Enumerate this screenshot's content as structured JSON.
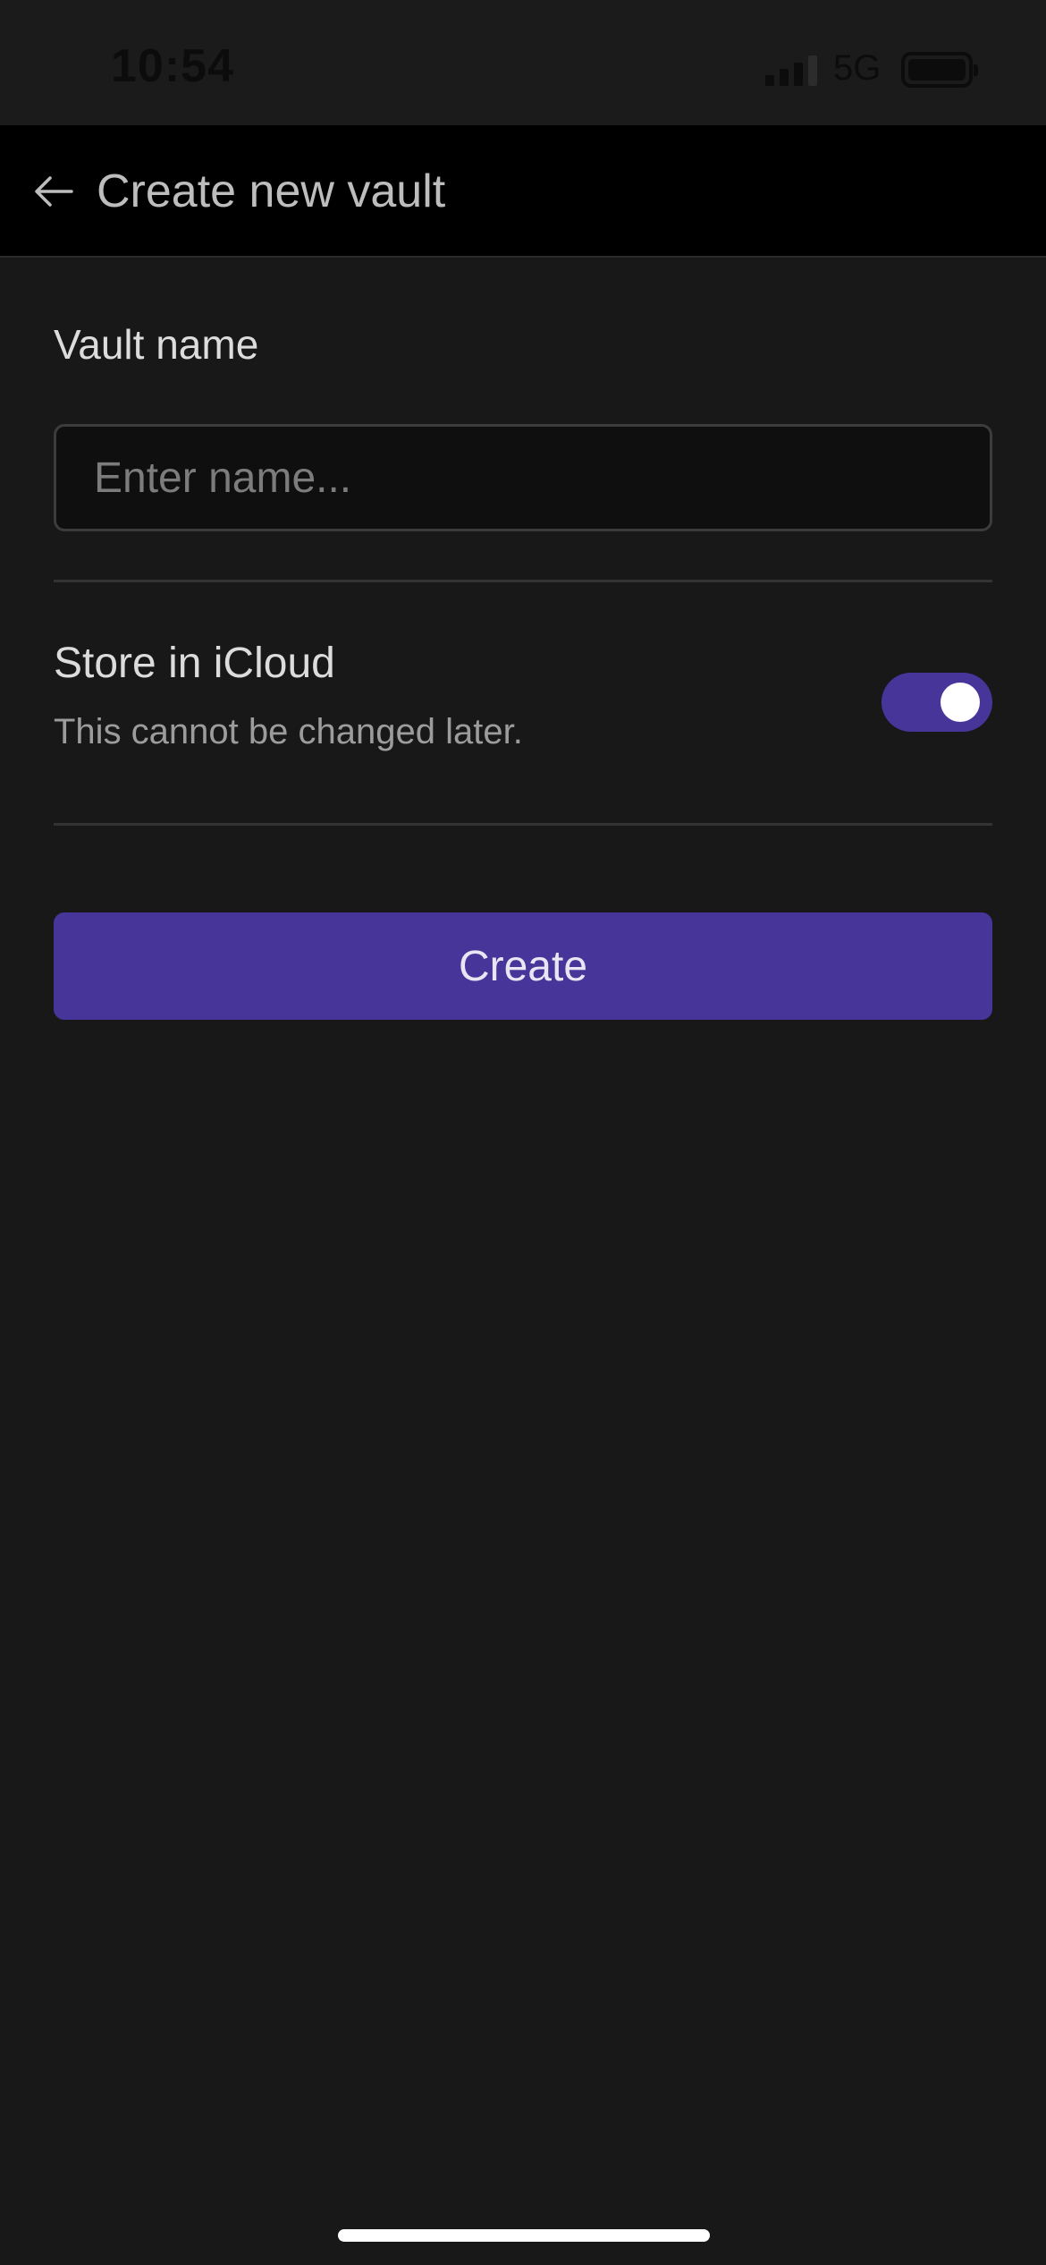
{
  "status_bar": {
    "time": "10:54",
    "network": "5G",
    "signal_icon": "cellular-signal-icon",
    "battery_icon": "battery-icon"
  },
  "header": {
    "back_icon": "arrow-left-icon",
    "title": "Create new vault"
  },
  "form": {
    "vault_name_label": "Vault name",
    "vault_name_value": "",
    "vault_name_placeholder": "Enter name...",
    "icloud_title": "Store in iCloud",
    "icloud_description": "This cannot be changed later.",
    "icloud_enabled": true,
    "create_label": "Create"
  },
  "colors": {
    "accent": "#47359a",
    "background": "#181818",
    "header_background": "#000000"
  }
}
